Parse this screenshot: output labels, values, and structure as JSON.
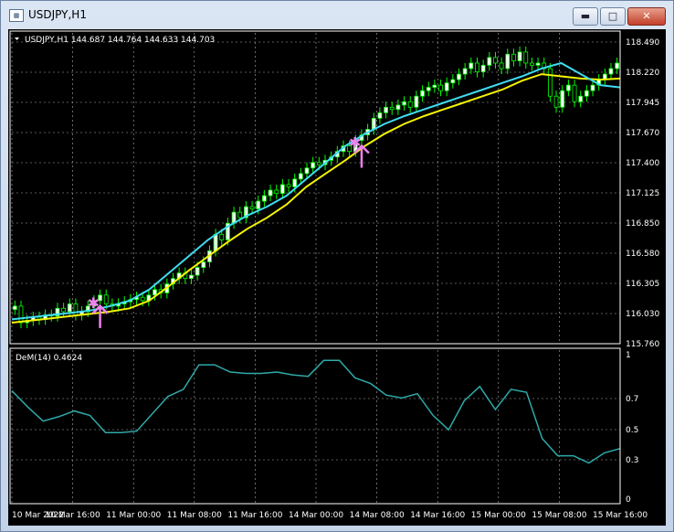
{
  "window": {
    "title": "USDJPY,H1",
    "app_icon": "chart-window-icon",
    "controls": {
      "minimize": "minimize-icon",
      "maximize": "maximize-icon",
      "close": "close-icon"
    }
  },
  "colors": {
    "background": "#000000",
    "grid": "#b0b0b0",
    "bull_candle": "#ffffff",
    "candle_wick": "#00ff00",
    "ma_fast": "#3fdcf0",
    "ma_slow": "#f5f500",
    "dem_line": "#2fa9a9",
    "signal": "#ee82ee",
    "axis_text": "#ffffff"
  },
  "main_pane": {
    "header": "USDJPY,H1  144.687 144.764 144.633 144.703",
    "price_ticks": [
      "118.490",
      "118.220",
      "117.945",
      "117.670",
      "117.400",
      "117.125",
      "116.850",
      "116.580",
      "116.305",
      "116.030",
      "115.760"
    ]
  },
  "indicator_pane": {
    "label": "DeM(14) 0.4624",
    "ticks": [
      "1",
      "0.7",
      "0.5",
      "0.3",
      "0"
    ]
  },
  "time_ticks": [
    "10 Mar 2022",
    "10 Mar 16:00",
    "11 Mar 00:00",
    "11 Mar 08:00",
    "11 Mar 16:00",
    "14 Mar 00:00",
    "14 Mar 08:00",
    "14 Mar 16:00",
    "15 Mar 00:00",
    "15 Mar 08:00",
    "15 Mar 16:00"
  ],
  "chart_data": {
    "type": "candlestick",
    "symbol": "USDJPY",
    "timeframe": "H1",
    "ylim": [
      115.76,
      118.49
    ],
    "closes": [
      116.1,
      115.95,
      115.97,
      116.0,
      115.98,
      116.02,
      116.01,
      116.08,
      116.05,
      116.12,
      116.02,
      116.05,
      116.1,
      116.15,
      116.2,
      116.12,
      116.1,
      116.12,
      116.14,
      116.16,
      116.18,
      116.15,
      116.2,
      116.25,
      116.22,
      116.3,
      116.35,
      116.4,
      116.35,
      116.38,
      116.45,
      116.5,
      116.6,
      116.75,
      116.7,
      116.85,
      116.95,
      116.9,
      117.0,
      116.98,
      117.05,
      117.1,
      117.15,
      117.12,
      117.2,
      117.18,
      117.25,
      117.3,
      117.35,
      117.4,
      117.38,
      117.42,
      117.45,
      117.5,
      117.55,
      117.5,
      117.6,
      117.65,
      117.7,
      117.8,
      117.85,
      117.9,
      117.88,
      117.92,
      117.95,
      117.9,
      118.0,
      118.05,
      118.08,
      118.1,
      118.05,
      118.12,
      118.15,
      118.2,
      118.25,
      118.3,
      118.22,
      118.28,
      118.35,
      118.3,
      118.25,
      118.38,
      118.32,
      118.4,
      118.3,
      118.28,
      118.3,
      118.25,
      118.0,
      117.9,
      118.05,
      118.1,
      117.95,
      118.0,
      118.05,
      118.1,
      118.15,
      118.2,
      118.25,
      118.3
    ],
    "ma_fast": [
      115.98,
      116.0,
      116.02,
      116.04,
      116.06,
      116.1,
      116.15,
      116.25,
      116.4,
      116.55,
      116.7,
      116.82,
      116.92,
      117.0,
      117.1,
      117.25,
      117.4,
      117.55,
      117.66,
      117.75,
      117.82,
      117.88,
      117.94,
      118.0,
      118.06,
      118.12,
      118.18,
      118.25,
      118.3,
      118.2,
      118.1,
      118.08
    ],
    "ma_slow": [
      115.95,
      115.97,
      115.99,
      116.01,
      116.03,
      116.05,
      116.08,
      116.15,
      116.28,
      116.42,
      116.55,
      116.68,
      116.8,
      116.9,
      117.02,
      117.18,
      117.3,
      117.42,
      117.55,
      117.66,
      117.75,
      117.82,
      117.88,
      117.94,
      118.0,
      118.06,
      118.14,
      118.2,
      118.18,
      118.16,
      118.15,
      118.16
    ],
    "dem": [
      0.75,
      0.64,
      0.54,
      0.57,
      0.61,
      0.58,
      0.46,
      0.46,
      0.47,
      0.59,
      0.71,
      0.76,
      0.93,
      0.93,
      0.88,
      0.87,
      0.87,
      0.88,
      0.86,
      0.85,
      0.96,
      0.96,
      0.84,
      0.8,
      0.72,
      0.7,
      0.73,
      0.58,
      0.48,
      0.68,
      0.78,
      0.62,
      0.76,
      0.74,
      0.42,
      0.3,
      0.3,
      0.25,
      0.32,
      0.35
    ],
    "signals": [
      {
        "kind": "buy-arrow",
        "index": 14
      },
      {
        "kind": "star",
        "index": 14
      },
      {
        "kind": "buy-arrow",
        "index": 57
      },
      {
        "kind": "star",
        "index": 57
      }
    ]
  }
}
